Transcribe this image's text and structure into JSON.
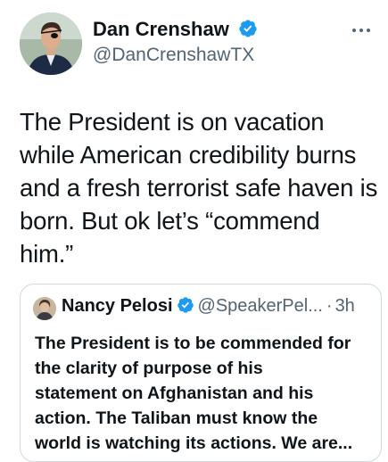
{
  "tweet": {
    "author": {
      "name": "Dan Crenshaw",
      "handle": "@DanCrenshawTX",
      "verified_icon": "verified-badge-icon"
    },
    "menu_icon": "more-horizontal-icon",
    "text_lines": [
      "The President is on vacation",
      "while American credibility burns",
      "and a fresh terrorist safe haven is",
      "born. But ok let’s “commend",
      "him.”"
    ]
  },
  "quoted_tweet": {
    "author": {
      "name": "Nancy Pelosi",
      "handle": "@SpeakerPel...",
      "verified_icon": "verified-badge-icon"
    },
    "separator": "·",
    "time": "3h",
    "text_lines": [
      "The President is to be commended for",
      "the clarity of purpose of his",
      "statement on Afghanistan and his",
      "action. The Taliban must know the",
      "world is watching its actions. We are..."
    ]
  },
  "colors": {
    "text_primary": "#0f1419",
    "text_secondary": "#536471",
    "verified_blue": "#1d9bf0",
    "border": "#cfd9de"
  }
}
